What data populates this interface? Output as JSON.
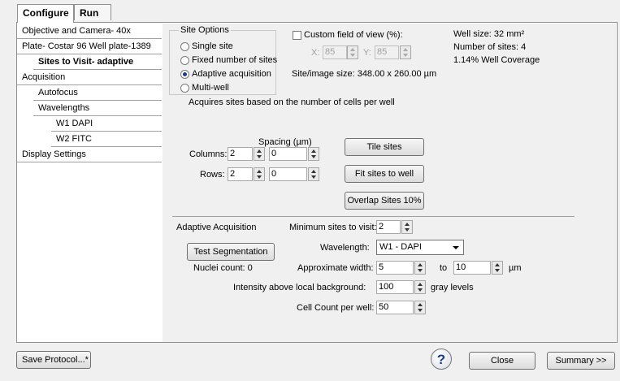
{
  "top_tabs": [
    "Configure",
    "Run"
  ],
  "nav": [
    {
      "label": "Objective and Camera- 40x",
      "indent": 0,
      "selected": false
    },
    {
      "label": "Plate- Costar 96 Well plate-1389",
      "indent": 0,
      "selected": false
    },
    {
      "label": "Sites to Visit- adaptive",
      "indent": 1,
      "selected": true
    },
    {
      "label": "Acquisition",
      "indent": 0,
      "selected": false
    },
    {
      "label": "Autofocus",
      "indent": 1,
      "selected": false
    },
    {
      "label": "Wavelengths",
      "indent": 1,
      "selected": false
    },
    {
      "label": "W1 DAPI",
      "indent": 2,
      "selected": false
    },
    {
      "label": "W2 FITC",
      "indent": 2,
      "selected": false
    },
    {
      "label": "Display Settings",
      "indent": 0,
      "selected": false
    }
  ],
  "site_options": {
    "title": "Site Options",
    "options": [
      "Single site",
      "Fixed number of sites",
      "Adaptive acquisition",
      "Multi-well"
    ],
    "selected_index": 2
  },
  "custom_fov": {
    "label": "Custom field of view (%):",
    "x_label": "X:",
    "x_value": "85",
    "y_label": "Y:",
    "y_value": "85"
  },
  "site_image_size": "Site/image size: 348.00 x 260.00  µm",
  "well_info": {
    "well_size": "Well size: 32 mm²",
    "number_of_sites": "Number of sites: 4",
    "coverage": "1.14% Well Coverage"
  },
  "description": "Acquires sites based on the number of cells per well",
  "grid": {
    "spacing_label": "Spacing (µm)",
    "columns_label": "Columns:",
    "columns_value": "2",
    "columns_spacing": "0",
    "rows_label": "Rows:",
    "rows_value": "2",
    "rows_spacing": "0"
  },
  "buttons": {
    "tile_sites": "Tile sites",
    "fit_sites": "Fit sites to well",
    "overlap_sites": "Overlap Sites 10%",
    "test_segmentation": "Test Segmentation",
    "save_protocol": "Save Protocol...*",
    "close": "Close",
    "summary": "Summary >>"
  },
  "adaptive": {
    "title": "Adaptive Acquisition",
    "min_sites_label": "Minimum sites to visit:",
    "min_sites_value": "2",
    "wavelength_label": "Wavelength:",
    "wavelength_value": "W1 - DAPI",
    "nuclei_count": "Nuclei count: 0",
    "approx_width_label": "Approximate width:",
    "approx_width_from": "5",
    "to_label": "to",
    "approx_width_to": "10",
    "width_unit": "µm",
    "intensity_label": "Intensity above local background:",
    "intensity_value": "100",
    "intensity_unit": "gray levels",
    "cell_count_label": "Cell Count per well:",
    "cell_count_value": "50"
  },
  "icons": {
    "help": "question-help-icon"
  }
}
